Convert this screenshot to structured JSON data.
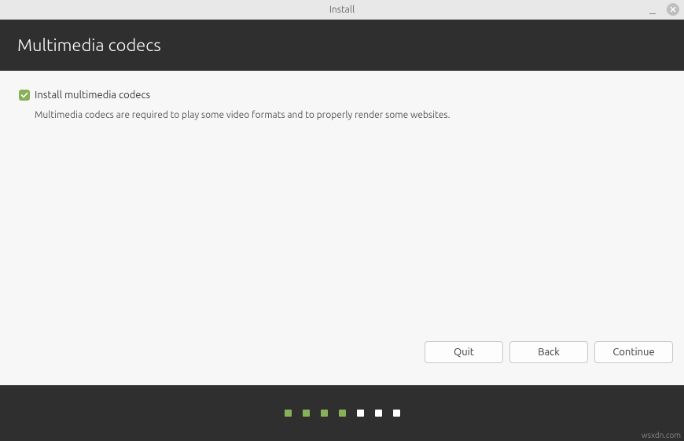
{
  "window": {
    "title": "Install"
  },
  "header": {
    "title": "Multimedia codecs"
  },
  "content": {
    "checkbox_label": "Install multimedia codecs",
    "checkbox_checked": true,
    "description": "Multimedia codecs are required to play some video formats and to properly render some websites."
  },
  "buttons": {
    "quit": "Quit",
    "back": "Back",
    "continue": "Continue"
  },
  "progress": {
    "total": 7,
    "current": 4
  },
  "watermark": "wsxdn.com"
}
